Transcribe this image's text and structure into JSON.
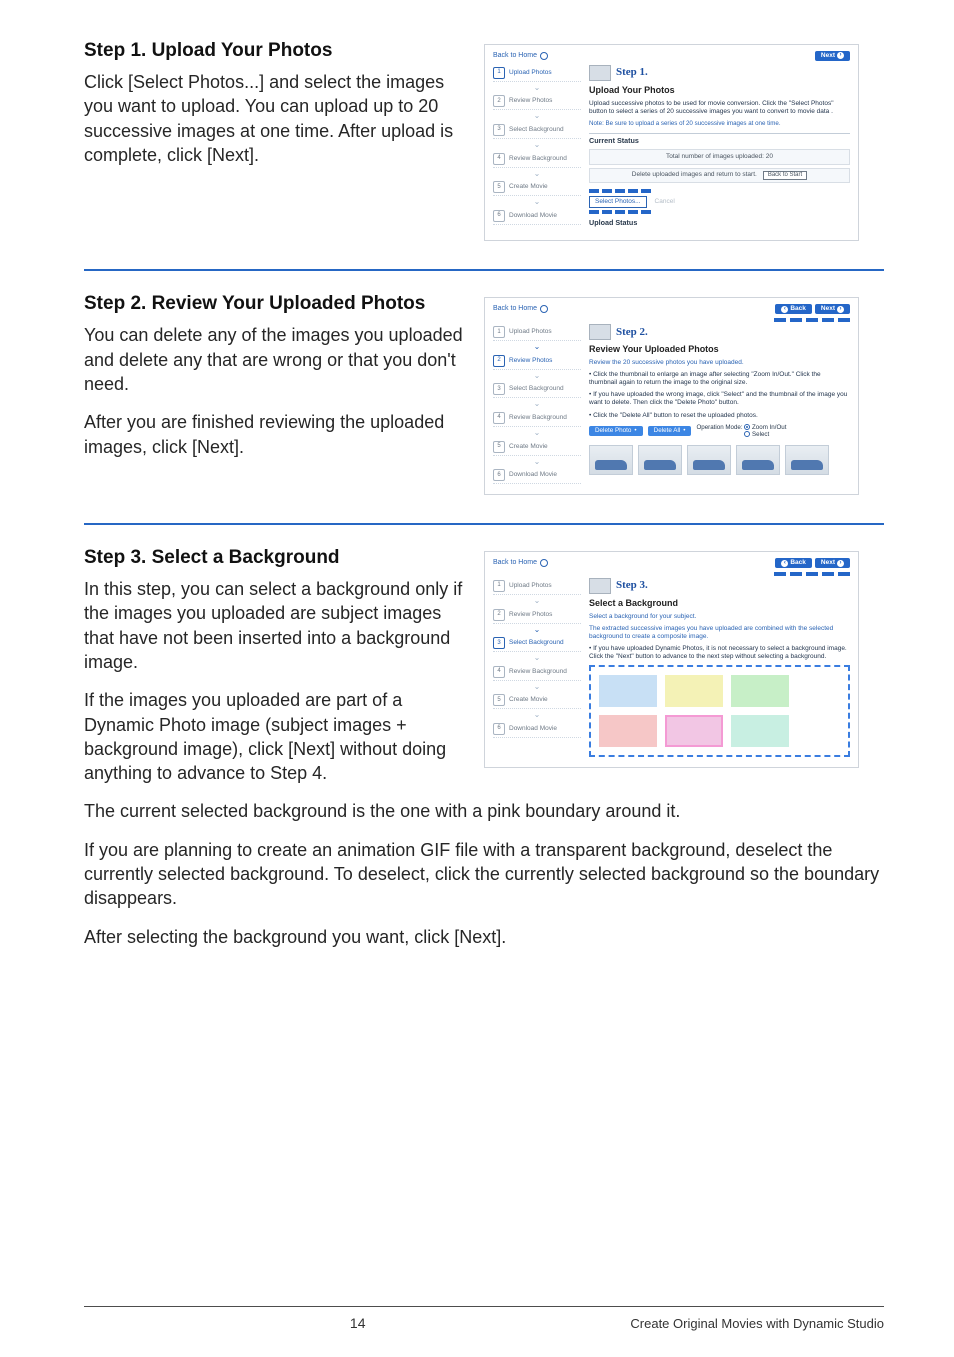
{
  "nav": {
    "back_home": "Back to Home",
    "back": "Back",
    "next": "Next"
  },
  "sidebar": {
    "items": [
      "Upload Photos",
      "Review Photos",
      "Select Background",
      "Review Background",
      "Create Movie",
      "Download Movie"
    ]
  },
  "step1": {
    "heading": "Step 1. Upload Your Photos",
    "body": "Click [Select Photos...] and select the images you want to upload. You can upload up to 20 successive images at one time. After upload is complete, click [Next].",
    "shot": {
      "step_label": "Step 1.",
      "panel_title": "Upload Your Photos",
      "desc": "Upload successive photos to be used for movie conversion. Click the \"Select Photos\" button to select a series of 20 successive images you want to convert to movie data .",
      "note": "Note: Be sure to upload a series of 20 successive images at one time.",
      "status_head": "Current Status",
      "total_line": "Total number of images uploaded: 20",
      "delete_line": "Delete uploaded images and return to start.",
      "back_to_start": "Back to Start",
      "select_photos": "Select Photos...",
      "cancel": "Cancel",
      "upload_head": "Upload Status"
    }
  },
  "step2": {
    "heading": "Step 2. Review Your Uploaded Photos",
    "body1": "You can delete any of the images you uploaded and delete any that are wrong or that you don't need.",
    "body2": "After you are finished reviewing the uploaded images, click [Next].",
    "shot": {
      "step_label": "Step 2.",
      "panel_title": "Review Your Uploaded Photos",
      "line_intro": "Review the 20 successive photos you have uploaded.",
      "bullet1": "Click the thumbnail to enlarge an image after selecting \"Zoom In/Out.\" Click the thumbnail again to return the image to the original size.",
      "bullet2": "If you have uploaded the wrong image, click \"Select\" and the thumbnail of the image you want to delete. Then click the \"Delete Photo\" button.",
      "bullet3": "Click the \"Delete All\" button to reset the uploaded photos.",
      "btn_delete_photo": "Delete Photo",
      "btn_delete_all": "Delete All",
      "op_mode_label": "Operation Mode:",
      "op_zoom": "Zoom In/Out",
      "op_select": "Select"
    }
  },
  "step3": {
    "heading": "Step 3. Select a Background",
    "body1": "In this step, you can select a background only if the images you uploaded are subject images that have not been inserted into a background image.",
    "body2": "If the images you uploaded are part of a Dynamic Photo image (subject images + background image), click [Next] without doing anything to advance to Step 4.",
    "body3": "The current selected background is the one with a pink boundary around it.",
    "body4": "If you are planning to create an animation GIF file with a transparent background, deselect the currently selected background. To deselect, click the currently selected background so the boundary disappears.",
    "body5": "After selecting the background you want, click [Next].",
    "shot": {
      "step_label": "Step 3.",
      "panel_title": "Select a Background",
      "line_intro": "Select a background for your subject.",
      "line_sub": "The extracted successive images you have uploaded are combined with the selected background to create a composite image.",
      "bullet1": "If you have uploaded Dynamic Photos, it is not necessary to select a background image. Click the \"Next\" button to advance to the next step without selecting a background."
    }
  },
  "footer": {
    "page_number": "14",
    "text": "Create Original Movies with Dynamic Studio"
  }
}
